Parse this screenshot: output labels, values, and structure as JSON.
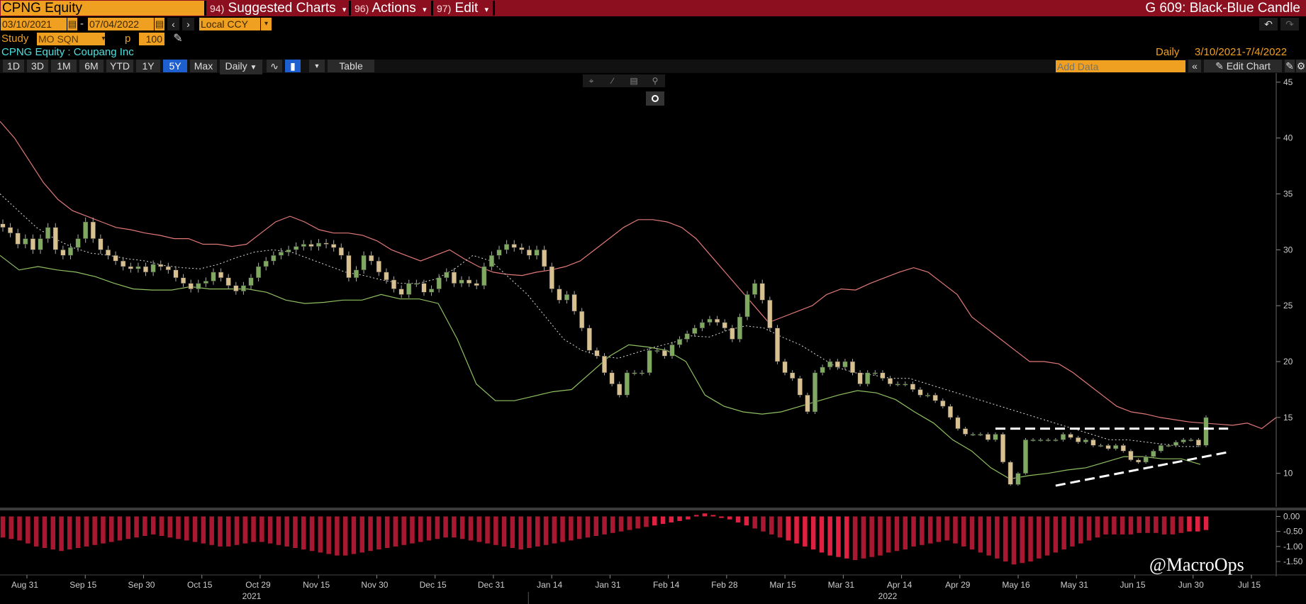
{
  "header": {
    "ticker": "CPNG Equity",
    "menus": [
      {
        "num": "94)",
        "label": "Suggested Charts"
      },
      {
        "num": "96)",
        "label": "Actions"
      },
      {
        "num": "97)",
        "label": "Edit"
      }
    ],
    "chart_template": "G 609: Black-Blue Candle"
  },
  "controls": {
    "start_date": "03/10/2021",
    "end_date": "07/04/2022",
    "date_sep": "-",
    "currency": "Local CCY",
    "study_label": "Study",
    "study_value": "MO SQN",
    "period_label": "p",
    "period_value": "100"
  },
  "info": {
    "security": "CPNG Equity : Coupang Inc",
    "frequency": "Daily",
    "range": "3/10/2021-7/4/2022"
  },
  "tabs": {
    "ranges": [
      "1D",
      "3D",
      "1M",
      "6M",
      "YTD",
      "1Y",
      "5Y",
      "Max"
    ],
    "active": "5Y",
    "period": "Daily",
    "table": "Table",
    "add_data_placeholder": "Add Data",
    "edit_chart": "Edit Chart"
  },
  "watermark": "@MacroOps",
  "colors": {
    "header_bg": "#8b0f1f",
    "field_bg": "#f0a020",
    "active_tab": "#1d5fcf",
    "upper_band": "#e07878",
    "lower_band": "#8fc060",
    "candle_up": "#7fa860",
    "candle_down": "#d8c090",
    "oscillator": "#e02040"
  },
  "chart_data": {
    "type": "candlestick",
    "ylim": [
      7,
      45.5
    ],
    "yticks": [
      10,
      15,
      20,
      25,
      30,
      35,
      40,
      45
    ],
    "xticks": [
      "Aug 31",
      "Sep 15",
      "Sep 30",
      "Oct 15",
      "Oct 29",
      "Nov 15",
      "Nov 30",
      "Dec 15",
      "Dec 31",
      "Jan 14",
      "Jan 31",
      "Feb 14",
      "Feb 28",
      "Mar 15",
      "Mar 31",
      "Apr 14",
      "Apr 29",
      "May 16",
      "May 31",
      "Jun 15",
      "Jun 30",
      "Jul 15"
    ],
    "years": [
      "2021",
      "2022"
    ],
    "close": [
      32,
      31.5,
      30.5,
      31,
      30,
      31,
      32,
      30,
      29.5,
      30.2,
      31,
      32.5,
      31,
      30,
      29.5,
      29,
      28.5,
      28.3,
      28.5,
      28,
      28.7,
      28.5,
      28.2,
      27.5,
      27,
      26.5,
      27,
      27.2,
      28,
      27.5,
      26.8,
      26.3,
      26.8,
      27.5,
      28.5,
      29,
      29.5,
      29.8,
      30,
      30.3,
      30.5,
      30.3,
      30.6,
      30.5,
      30.2,
      29.5,
      27.5,
      28.2,
      29.5,
      29,
      28,
      27.3,
      26.5,
      26,
      27,
      27,
      26.2,
      26.5,
      27.5,
      28,
      27,
      27.3,
      27,
      26.8,
      28.5,
      29.5,
      30,
      30.5,
      30.2,
      30,
      29.5,
      30,
      28.5,
      26.5,
      25.5,
      26,
      24.5,
      23,
      21,
      20.5,
      19,
      18,
      17,
      19,
      19,
      19,
      21,
      21,
      20.5,
      21.5,
      22,
      22.5,
      23,
      23.5,
      23.8,
      23.5,
      23,
      22,
      24,
      26,
      27,
      25.5,
      23,
      20,
      19,
      18.5,
      17,
      15.5,
      19,
      19.5,
      20,
      19.5,
      20,
      19,
      18,
      19,
      19,
      18.5,
      18,
      18,
      18,
      17.5,
      17,
      17,
      16.5,
      16,
      15,
      14,
      13.5,
      13.5,
      13.5,
      13,
      13.5,
      11,
      9,
      10,
      13,
      13,
      13,
      13,
      13,
      13.5,
      13.2,
      12.8,
      13,
      12.5,
      12.5,
      12.2,
      12.5,
      12,
      11.2,
      11,
      11.5,
      12,
      12.5,
      12.5,
      12.8,
      13,
      13,
      12.5,
      15
    ],
    "upper_band": [
      41.5,
      40,
      38,
      36,
      34.5,
      33.5,
      33,
      32.5,
      32,
      31.8,
      31.5,
      31.3,
      31,
      31,
      30.5,
      30.5,
      30.3,
      30.5,
      31.5,
      32.5,
      33,
      32.5,
      31.8,
      31.5,
      31.5,
      31.3,
      30.8,
      30,
      29.5,
      29,
      29.5,
      30,
      29.2,
      28.5,
      28,
      27.8,
      27.7,
      28,
      28.2,
      28.5,
      29,
      30,
      31,
      32,
      32.7,
      32.7,
      32.5,
      32,
      31,
      29.5,
      28,
      26.5,
      25,
      23.5,
      24,
      24.5,
      25,
      26,
      26.5,
      26.4,
      27,
      27.5,
      28,
      28.4,
      28,
      27,
      26,
      24,
      23,
      22,
      21,
      20,
      20,
      19.8,
      19,
      18,
      17,
      16,
      15.5,
      15.3,
      15,
      14.8,
      14.6,
      14.5,
      14.4,
      14.3,
      14.5,
      14,
      15
    ],
    "mid_band": [
      35,
      33.5,
      32,
      31,
      30.2,
      29.7,
      29.5,
      29.2,
      29,
      28.6,
      28.4,
      28.3,
      28.7,
      29.3,
      29.8,
      30,
      29.8,
      29.2,
      28.6,
      28,
      27.7,
      27.3,
      27,
      27,
      27.4,
      28.3,
      29.5,
      29,
      27.5,
      26,
      24,
      22,
      21,
      20.5,
      20.3,
      20.8,
      21.3,
      21.7,
      22.3,
      22.2,
      22.8,
      23.2,
      23,
      22.2,
      21.5,
      20.5,
      19.5,
      19,
      18.8,
      18.5,
      18.5,
      18,
      17.5,
      17,
      16.5,
      16,
      15.5,
      15,
      14.5,
      14,
      13.5,
      13,
      13,
      12.8,
      12.6,
      12.4,
      12.4
    ],
    "lower_band": [
      29.5,
      28.2,
      28.5,
      28.2,
      28,
      27.6,
      27,
      26.5,
      26.4,
      26.4,
      26.7,
      26.5,
      26.5,
      26.5,
      26.2,
      25.5,
      25.2,
      25.3,
      25.5,
      25.5,
      26,
      25.6,
      25.6,
      25.2,
      22,
      18,
      16.5,
      16.5,
      16.9,
      17.3,
      17.5,
      19,
      20.5,
      21.5,
      21.3,
      21,
      20,
      17,
      16,
      15.5,
      15.3,
      15.5,
      16,
      16.5,
      17,
      17.4,
      17.2,
      16.6,
      15.5,
      14.5,
      13,
      12,
      10.5,
      9.5,
      9.8,
      10,
      10.3,
      10.5,
      11,
      11.5,
      11.5,
      11.3,
      11.3,
      10.8
    ],
    "oscillator_ylim": [
      -1.9,
      0.2
    ],
    "oscillator_yticks": [
      0.0,
      -0.5,
      -1.0,
      -1.5
    ],
    "oscillator_yticklabels": [
      "0.00",
      "-0.50",
      "-1.00",
      "-1.50"
    ],
    "oscillator_values": [
      -0.7,
      -0.75,
      -0.8,
      -0.9,
      -1.0,
      -1.05,
      -1.1,
      -1.15,
      -1.1,
      -1.05,
      -1.0,
      -0.95,
      -0.9,
      -0.85,
      -0.8,
      -0.75,
      -0.7,
      -0.65,
      -0.6,
      -0.65,
      -0.7,
      -0.75,
      -0.8,
      -0.85,
      -0.9,
      -0.95,
      -1.0,
      -1.0,
      -0.95,
      -0.9,
      -0.85,
      -0.85,
      -0.9,
      -0.95,
      -1.0,
      -1.05,
      -1.1,
      -1.15,
      -1.2,
      -1.25,
      -1.3,
      -1.3,
      -1.25,
      -1.2,
      -1.15,
      -1.1,
      -1.05,
      -1.0,
      -0.95,
      -0.9,
      -0.85,
      -0.8,
      -0.75,
      -0.7,
      -0.7,
      -0.75,
      -0.8,
      -0.85,
      -0.9,
      -0.95,
      -1.0,
      -1.05,
      -1.1,
      -1.05,
      -1.0,
      -0.95,
      -0.9,
      -0.85,
      -0.8,
      -0.75,
      -0.7,
      -0.65,
      -0.6,
      -0.55,
      -0.5,
      -0.45,
      -0.4,
      -0.35,
      -0.3,
      -0.25,
      -0.2,
      -0.15,
      -0.1,
      0.05,
      0.1,
      0.05,
      -0.05,
      -0.1,
      -0.2,
      -0.3,
      -0.4,
      -0.5,
      -0.6,
      -0.7,
      -0.8,
      -0.9,
      -1.0,
      -1.1,
      -1.2,
      -1.3,
      -1.35,
      -1.4,
      -1.45,
      -1.4,
      -1.35,
      -1.3,
      -1.2,
      -1.15,
      -1.1,
      -1.0,
      -0.95,
      -0.9,
      -0.85,
      -0.8,
      -0.9,
      -1.0,
      -1.1,
      -1.2,
      -1.3,
      -1.4,
      -1.5,
      -1.6,
      -1.55,
      -1.5,
      -1.4,
      -1.3,
      -1.2,
      -1.1,
      -1.0,
      -0.9,
      -0.8,
      -0.7,
      -0.6,
      -0.6,
      -0.6,
      -0.6,
      -0.55,
      -0.55,
      -0.55,
      -0.6,
      -0.6,
      -0.55,
      -0.5,
      -0.5,
      -0.45
    ]
  }
}
